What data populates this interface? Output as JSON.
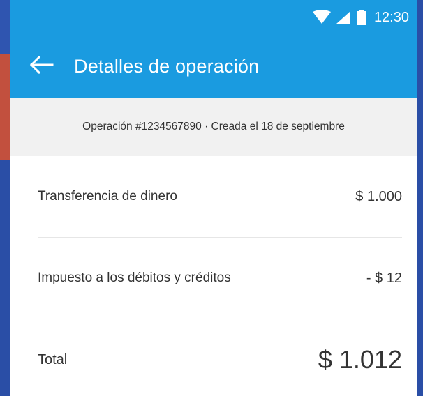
{
  "status_bar": {
    "time": "12:30",
    "icons": [
      "wifi-icon",
      "signal-icon",
      "battery-icon"
    ]
  },
  "toolbar": {
    "back_icon": "arrow-left-icon",
    "title": "Detalles de operación"
  },
  "operation": {
    "summary": "Operación #1234567890 · Creada el 18 de septiembre"
  },
  "details": [
    {
      "label": "Transferencia de dinero",
      "value": "$ 1.000"
    },
    {
      "label": "Impuesto a los débitos y créditos",
      "value": "- $ 12"
    }
  ],
  "total": {
    "label": "Total",
    "value": "$ 1.012"
  },
  "colors": {
    "appbar": "#1a9be0",
    "banner": "#f1f1f1",
    "text": "#333333"
  }
}
